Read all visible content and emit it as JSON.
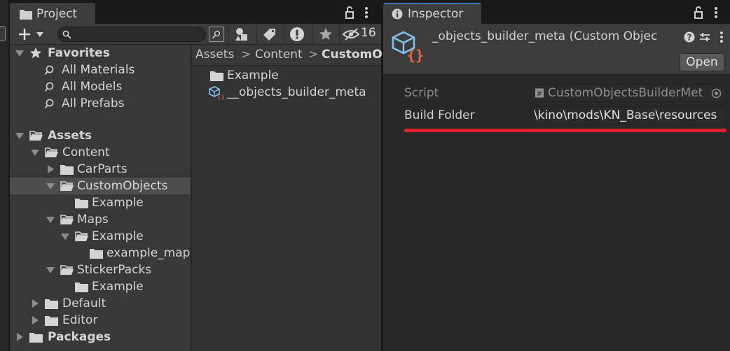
{
  "project": {
    "tab_label": "Project",
    "search_value": "",
    "visibility_count": "16",
    "tree": {
      "favorites_label": "Favorites",
      "favorites": [
        "All Materials",
        "All Models",
        "All Prefabs"
      ],
      "assets_label": "Assets",
      "content_label": "Content",
      "carparts_label": "CarParts",
      "customobjects_label": "CustomObjects",
      "customobjects_example_label": "Example",
      "maps_label": "Maps",
      "maps_example_label": "Example",
      "example_map_label": "example_map",
      "stickerpacks_label": "StickerPacks",
      "stickerpacks_example_label": "Example",
      "default_label": "Default",
      "editor_label": "Editor",
      "packages_label": "Packages"
    },
    "breadcrumb": [
      "Assets",
      "Content",
      "CustomO"
    ],
    "breadcrumb_sep": ">",
    "content_items": [
      "Example",
      "__objects_builder_meta"
    ]
  },
  "inspector": {
    "tab_label": "Inspector",
    "object_title": "_objects_builder_meta (Custom Objec",
    "open_label": "Open",
    "script_label": "Script",
    "script_value": "CustomObjectsBuilderMet",
    "build_folder_label": "Build Folder",
    "build_folder_value": "\\kino\\mods\\KN_Base\\resources"
  },
  "colors": {
    "accent_underline": "#e0212b",
    "script_icon_blue": "#7fc4ee",
    "script_icon_orange": "#f0643a"
  },
  "icons": [
    "folder-icon",
    "lock-icon",
    "kebab-menu-icon",
    "plus-icon",
    "search-icon",
    "star-icon",
    "info-icon",
    "help-icon",
    "settings-icon",
    "asset-file-icon",
    "visibility-icon"
  ]
}
